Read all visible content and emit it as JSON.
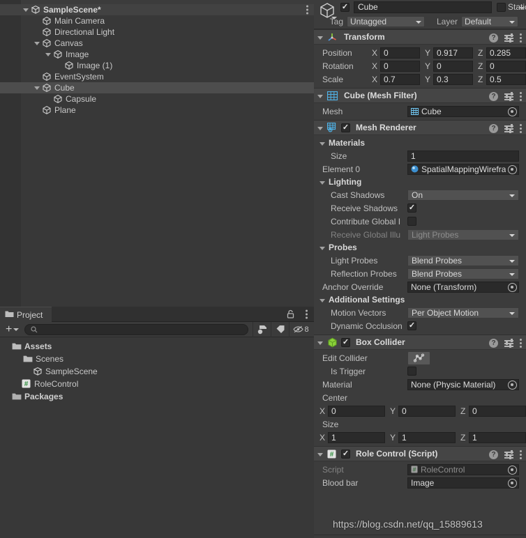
{
  "hierarchy": {
    "panel_name": "Hierarchy",
    "rows": [
      {
        "label": "SampleScene*",
        "indent": 0,
        "twisty": "open",
        "icon": "unity-scene-icon",
        "selected": false,
        "scene": true,
        "kebab": true
      },
      {
        "label": "Main Camera",
        "indent": 1,
        "twisty": "none",
        "icon": "gameobject-cube-icon",
        "selected": false,
        "scene": false,
        "kebab": false
      },
      {
        "label": "Directional Light",
        "indent": 1,
        "twisty": "none",
        "icon": "gameobject-cube-icon",
        "selected": false,
        "scene": false,
        "kebab": false
      },
      {
        "label": "Canvas",
        "indent": 1,
        "twisty": "open",
        "icon": "gameobject-cube-icon",
        "selected": false,
        "scene": false,
        "kebab": false
      },
      {
        "label": "Image",
        "indent": 2,
        "twisty": "open",
        "icon": "gameobject-cube-icon",
        "selected": false,
        "scene": false,
        "kebab": false
      },
      {
        "label": "Image (1)",
        "indent": 3,
        "twisty": "none",
        "icon": "gameobject-cube-icon",
        "selected": false,
        "scene": false,
        "kebab": false
      },
      {
        "label": "EventSystem",
        "indent": 1,
        "twisty": "none",
        "icon": "gameobject-cube-icon",
        "selected": false,
        "scene": false,
        "kebab": false
      },
      {
        "label": "Cube",
        "indent": 1,
        "twisty": "open",
        "icon": "gameobject-cube-icon",
        "selected": true,
        "scene": false,
        "kebab": false
      },
      {
        "label": "Capsule",
        "indent": 2,
        "twisty": "none",
        "icon": "gameobject-cube-icon",
        "selected": false,
        "scene": false,
        "kebab": false
      },
      {
        "label": "Plane",
        "indent": 1,
        "twisty": "none",
        "icon": "gameobject-cube-icon",
        "selected": false,
        "scene": false,
        "kebab": false
      }
    ]
  },
  "project": {
    "tab_label": "Project",
    "create_label": "+",
    "search_placeholder": "",
    "hidden_count": "8",
    "rows": [
      {
        "label": "Assets",
        "indent": 0,
        "twisty": "open",
        "icon": "folder-open-icon",
        "bold": true
      },
      {
        "label": "Scenes",
        "indent": 1,
        "twisty": "open",
        "icon": "folder-open-icon",
        "bold": false
      },
      {
        "label": "SampleScene",
        "indent": 2,
        "twisty": "none",
        "icon": "unity-scene-icon",
        "bold": false
      },
      {
        "label": "RoleControl",
        "indent": 1,
        "twisty": "none",
        "icon": "csharp-script-icon",
        "bold": false
      },
      {
        "label": "Packages",
        "indent": 0,
        "twisty": "closed",
        "icon": "folder-closed-icon",
        "bold": true
      }
    ]
  },
  "inspector": {
    "object_name": "Cube",
    "object_enabled": true,
    "static_label": "Static",
    "static_checked": false,
    "tag_label": "Tag",
    "tag_value": "Untagged",
    "layer_label": "Layer",
    "layer_value": "Default",
    "components": [
      {
        "name": "transform",
        "title": "Transform",
        "icon": "transform-axis-icon",
        "has_enable_checkbox": false,
        "rows": [
          {
            "type": "vec3",
            "label": "Position",
            "x": "0",
            "y": "0.917",
            "z": "0.285"
          },
          {
            "type": "vec3",
            "label": "Rotation",
            "x": "0",
            "y": "0",
            "z": "0"
          },
          {
            "type": "vec3",
            "label": "Scale",
            "x": "0.7",
            "y": "0.3",
            "z": "0.5"
          }
        ]
      },
      {
        "name": "mesh-filter",
        "title": "Cube (Mesh Filter)",
        "icon": "mesh-filter-grid-icon",
        "has_enable_checkbox": false,
        "rows": [
          {
            "type": "object",
            "label": "Mesh",
            "value": "Cube",
            "badge": "mesh-icon"
          }
        ]
      },
      {
        "name": "mesh-renderer",
        "title": "Mesh Renderer",
        "icon": "mesh-renderer-icon",
        "has_enable_checkbox": true,
        "enabled": true,
        "rows": [
          {
            "type": "foldout",
            "label": "Materials"
          },
          {
            "type": "field",
            "label": "Size",
            "value": "1"
          },
          {
            "type": "object",
            "label": "Element 0",
            "value": "SpatialMappingWirefra",
            "badge": "material-sphere-icon"
          },
          {
            "type": "foldout",
            "label": "Lighting"
          },
          {
            "type": "dropdown",
            "label": "Cast Shadows",
            "value": "On",
            "disabled": false
          },
          {
            "type": "checkbox",
            "label": "Receive Shadows",
            "checked": true
          },
          {
            "type": "checkbox",
            "label": "Contribute Global I",
            "checked": false
          },
          {
            "type": "dropdown",
            "label": "Receive Global Illu",
            "value": "Light Probes",
            "disabled": true
          },
          {
            "type": "foldout",
            "label": "Probes"
          },
          {
            "type": "dropdown",
            "label": "Light Probes",
            "value": "Blend Probes",
            "disabled": false
          },
          {
            "type": "dropdown",
            "label": "Reflection Probes",
            "value": "Blend Probes",
            "disabled": false
          },
          {
            "type": "object",
            "label": "Anchor Override",
            "value": "None (Transform)",
            "badge": "none"
          },
          {
            "type": "foldout",
            "label": "Additional Settings"
          },
          {
            "type": "dropdown",
            "label": "Motion Vectors",
            "value": "Per Object Motion",
            "disabled": false
          },
          {
            "type": "checkbox",
            "label": "Dynamic Occlusion",
            "checked": true
          }
        ]
      },
      {
        "name": "box-collider",
        "title": "Box Collider",
        "icon": "box-collider-icon",
        "has_enable_checkbox": true,
        "enabled": true,
        "rows": [
          {
            "type": "editcollider",
            "label": "Edit Collider"
          },
          {
            "type": "checkbox",
            "label": "Is Trigger",
            "checked": false
          },
          {
            "type": "object",
            "label": "Material",
            "value": "None (Physic Material)",
            "badge": "none"
          },
          {
            "type": "grouplabel",
            "label": "Center"
          },
          {
            "type": "vec3",
            "label": "",
            "x": "0",
            "y": "0",
            "z": "0"
          },
          {
            "type": "grouplabel",
            "label": "Size"
          },
          {
            "type": "vec3",
            "label": "",
            "x": "1",
            "y": "1",
            "z": "1"
          }
        ]
      },
      {
        "name": "role-control-script",
        "title": "Role Control (Script)",
        "icon": "csharp-script-icon",
        "has_enable_checkbox": true,
        "enabled": true,
        "rows": [
          {
            "type": "object",
            "label": "Script",
            "value": "RoleControl",
            "badge": "script-icon",
            "disabled": true
          },
          {
            "type": "object",
            "label": "Blood bar",
            "value": "Image",
            "badge": "none"
          }
        ]
      }
    ]
  },
  "watermark": {
    "text": "https://blog.csdn.net/qq_15889613"
  },
  "colors": {
    "panel_bg": "#3c3c3c",
    "hierarchy_bg": "#383838",
    "header_bg": "#454545",
    "field_bg": "#2a2a2a",
    "dropdown_bg": "#515151",
    "selection": "#4d4d4d",
    "text": "#c4c4c4",
    "accent_blue": "#4fb3e8",
    "accent_green": "#7fd13b"
  }
}
